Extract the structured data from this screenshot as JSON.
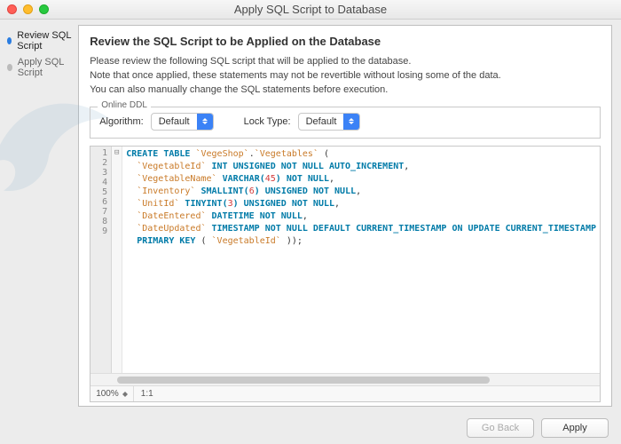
{
  "window": {
    "title": "Apply SQL Script to Database"
  },
  "sidebar": {
    "steps": [
      {
        "label": "Review SQL Script",
        "active": true
      },
      {
        "label": "Apply SQL Script",
        "active": false
      }
    ]
  },
  "main": {
    "heading": "Review the SQL Script to be Applied on the Database",
    "intro_line1": "Please review the following SQL script that will be applied to the database.",
    "intro_line2": "Note that once applied, these statements may not be revertible without losing some of the data.",
    "intro_line3": "You can also manually change the SQL statements before execution.",
    "ddl": {
      "legend": "Online DDL",
      "algorithm_label": "Algorithm:",
      "algorithm_value": "Default",
      "locktype_label": "Lock Type:",
      "locktype_value": "Default"
    },
    "editor": {
      "lines": [
        "1",
        "2",
        "3",
        "4",
        "5",
        "6",
        "7",
        "8",
        "9"
      ],
      "fold_marker": "⊟",
      "sql_tokens": {
        "l1": {
          "kw1": "CREATE TABLE",
          "id1": "`VegeShop`",
          "dot": ".",
          "id2": "`Vegetables`",
          "paren": " ("
        },
        "l2": {
          "id": "  `VegetableId`",
          "rest": " INT UNSIGNED NOT NULL AUTO_INCREMENT",
          "comma": ","
        },
        "l3": {
          "id": "  `VegetableName`",
          "kw": " VARCHAR(",
          "num": "45",
          "rest": ") NOT NULL",
          "comma": ","
        },
        "l4": {
          "id": "  `Inventory`",
          "kw": " SMALLINT(",
          "num": "6",
          "rest": ") UNSIGNED NOT NULL",
          "comma": ","
        },
        "l5": {
          "id": "  `UnitId`",
          "kw": " TINYINT(",
          "num": "3",
          "rest": ") UNSIGNED NOT NULL",
          "comma": ","
        },
        "l6": {
          "id": "  `DateEntered`",
          "rest": " DATETIME NOT NULL",
          "comma": ","
        },
        "l7": {
          "id": "  `DateUpdated`",
          "rest": " TIMESTAMP NOT NULL DEFAULT CURRENT_TIMESTAMP ON UPDATE CURRENT_TIMESTAMP"
        },
        "l8": {
          "kw": "  PRIMARY KEY",
          "paren": " (",
          "id": " `VegetableId`",
          "close": " ));"
        }
      },
      "zoom": "100%",
      "ratio": "1:1"
    }
  },
  "footer": {
    "back": "Go Back",
    "apply": "Apply"
  }
}
